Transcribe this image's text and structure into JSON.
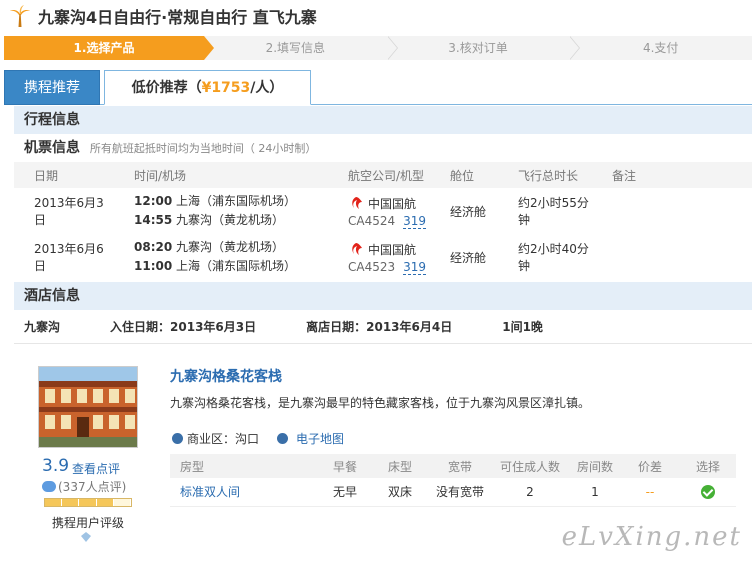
{
  "header": {
    "title": "九寨沟4日自由行·常规自由行 直飞九寨"
  },
  "steps": [
    {
      "label": "1.选择产品",
      "active": true
    },
    {
      "label": "2.填写信息",
      "active": false
    },
    {
      "label": "3.核对订单",
      "active": false
    },
    {
      "label": "4.支付",
      "active": false
    }
  ],
  "tabs": {
    "ctrip": "携程推荐",
    "low_label": "低价推荐（",
    "low_price": "¥1753",
    "low_suffix": "/人）"
  },
  "itinerary": {
    "section_title": "行程信息",
    "ticket_title": "机票信息",
    "ticket_note": "所有航班起抵时间均为当地时间（ 24小时制）",
    "columns": [
      "日期",
      "时间/机场",
      "航空公司/机型",
      "舱位",
      "飞行总时长",
      "备注"
    ],
    "flights": [
      {
        "date": "2013年6月3日",
        "dep_time": "12:00",
        "dep_airport": "上海（浦东国际机场）",
        "arr_time": "14:55",
        "arr_airport": "九寨沟（黄龙机场）",
        "airline": "中国国航",
        "flight_no": "CA4524",
        "plane": "319",
        "cabin": "经济舱",
        "duration": "约2小时55分钟"
      },
      {
        "date": "2013年6月6日",
        "dep_time": "08:20",
        "dep_airport": "九寨沟（黄龙机场）",
        "arr_time": "11:00",
        "arr_airport": "上海（浦东国际机场）",
        "airline": "中国国航",
        "flight_no": "CA4523",
        "plane": "319",
        "cabin": "经济舱",
        "duration": "约2小时40分钟"
      }
    ]
  },
  "hotel_section": {
    "section_title": "酒店信息",
    "city": "九寨沟",
    "checkin": "入住日期：2013年6月3日",
    "checkout": "离店日期：2013年6月4日",
    "nights": "1间1晚",
    "name": "九寨沟格桑花客栈",
    "desc": "九寨沟格桑花客栈，是九寨沟最早的特色藏家客栈，位于九寨沟风景区漳扎镇。",
    "district": "商业区：沟口",
    "map": "电子地图",
    "score": "3.9",
    "score_link": "查看点评",
    "reviews": "(337人点评)",
    "user_rating": "携程用户评级",
    "level_fraction": 0.8,
    "room_columns": [
      "房型",
      "早餐",
      "床型",
      "宽带",
      "可住成人数",
      "房间数",
      "价差",
      "选择"
    ],
    "rooms": [
      {
        "type": "标准双人间",
        "breakfast": "无早",
        "bed": "双床",
        "broadband": "没有宽带",
        "adults": "2",
        "count": "1",
        "diff": "--"
      }
    ]
  },
  "watermark": "eLvXing.net",
  "colors": {
    "accent": "#f59d1e",
    "blue": "#3a87c6",
    "link": "#2b6cb0",
    "section_bg": "#e4eef8"
  }
}
